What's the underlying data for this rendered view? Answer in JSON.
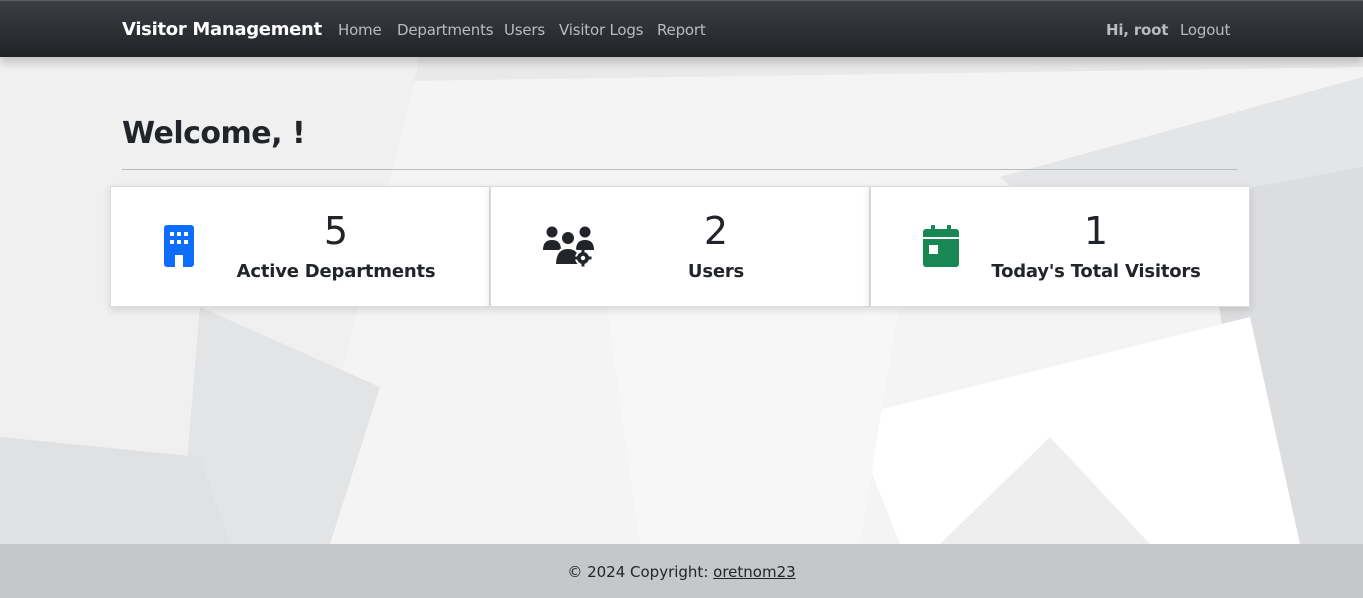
{
  "navbar": {
    "brand": "Visitor Management",
    "links": [
      "Home",
      "Departments",
      "Users",
      "Visitor Logs",
      "Report"
    ],
    "greeting": "Hi, root",
    "logout": "Logout"
  },
  "main": {
    "title": "Welcome, !",
    "cards": [
      {
        "value": "5",
        "label": "Active Departments",
        "icon": "building-icon",
        "color": "#0d6efd"
      },
      {
        "value": "2",
        "label": "Users",
        "icon": "users-gear-icon",
        "color": "#212529"
      },
      {
        "value": "1",
        "label": "Today's Total Visitors",
        "icon": "calendar-icon",
        "color": "#198754"
      }
    ]
  },
  "footer": {
    "text": "© 2024 Copyright:",
    "link": "oretnom23"
  }
}
